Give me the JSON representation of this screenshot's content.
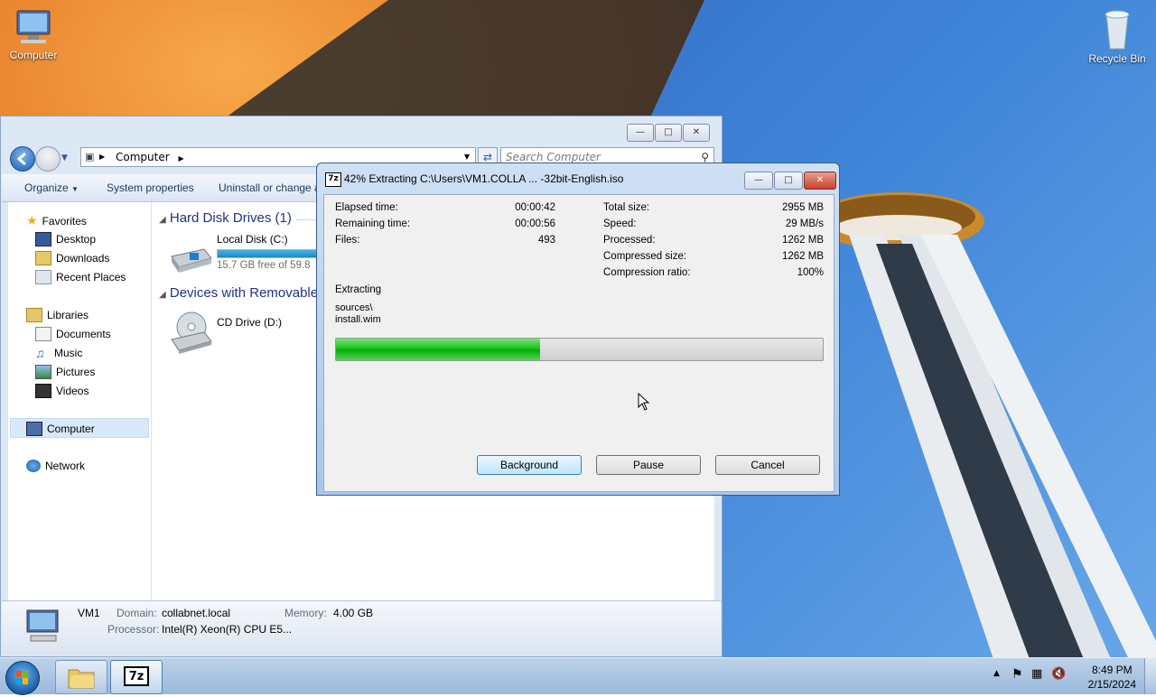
{
  "desktop": {
    "icons": [
      {
        "label": "Computer"
      },
      {
        "label": "Recycle Bin"
      }
    ]
  },
  "explorer": {
    "breadcrumb": [
      "Computer"
    ],
    "search_placeholder": "Search Computer",
    "commands": [
      "Organize",
      "System properties",
      "Uninstall or change a"
    ],
    "nav": {
      "favorites": {
        "label": "Favorites",
        "items": [
          "Desktop",
          "Downloads",
          "Recent Places"
        ]
      },
      "libraries": {
        "label": "Libraries",
        "items": [
          "Documents",
          "Music",
          "Pictures",
          "Videos"
        ]
      },
      "computer": "Computer",
      "network": "Network"
    },
    "groups": {
      "hdd": {
        "label": "Hard Disk Drives (1)",
        "drive": "Local Disk (C:)",
        "free": "15.7 GB free of 59.8",
        "used_fraction": 0.74
      },
      "removable": {
        "label": "Devices with Removable",
        "drive": "CD Drive (D:)"
      }
    },
    "details": {
      "name": "VM1",
      "domain_label": "Domain:",
      "domain": "collabnet.local",
      "memory_label": "Memory:",
      "memory": "4.00 GB",
      "processor_label": "Processor:",
      "processor": "Intel(R) Xeon(R) CPU E5..."
    }
  },
  "dialog": {
    "app_icon": "7z",
    "title": "42% Extracting C:\\Users\\VM1.COLLA ... -32bit-English.iso",
    "stats_left": [
      {
        "label": "Elapsed time:",
        "value": "00:00:42"
      },
      {
        "label": "Remaining time:",
        "value": "00:00:56"
      },
      {
        "label": "Files:",
        "value": "493"
      }
    ],
    "stats_right": [
      {
        "label": "Total size:",
        "value": "2955 MB"
      },
      {
        "label": "Speed:",
        "value": "29 MB/s"
      },
      {
        "label": "Processed:",
        "value": "1262 MB"
      },
      {
        "label": "Compressed size:",
        "value": "1262 MB"
      },
      {
        "label": "Compression ratio:",
        "value": "100%"
      }
    ],
    "status": "Extracting",
    "file_path": "sources\\",
    "file_name": "install.wim",
    "progress": 0.42,
    "buttons": {
      "background": "Background",
      "pause": "Pause",
      "cancel": "Cancel"
    }
  },
  "taskbar": {
    "tray_time": "8:49 PM",
    "tray_date": "2/15/2024",
    "seven_zip_label": "7z"
  }
}
